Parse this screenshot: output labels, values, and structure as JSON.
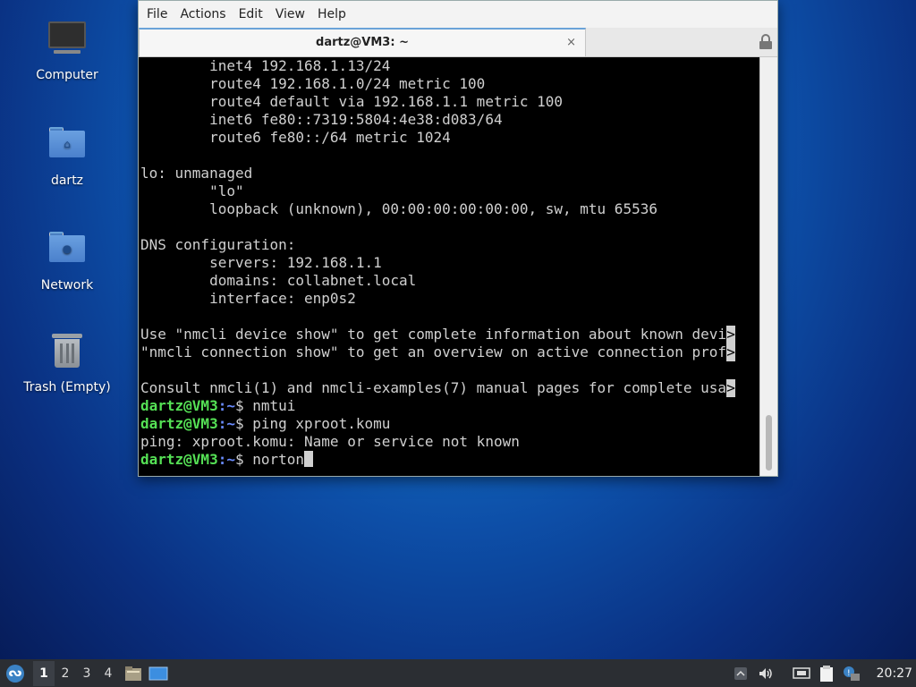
{
  "desktop": {
    "icons": [
      {
        "label": "Computer"
      },
      {
        "label": "dartz"
      },
      {
        "label": "Network"
      },
      {
        "label": "Trash (Empty)"
      }
    ]
  },
  "window": {
    "menu": [
      "File",
      "Actions",
      "Edit",
      "View",
      "Help"
    ],
    "tab_title": "dartz@VM3: ~",
    "tab_close": "×",
    "terminal": {
      "lines": [
        "        inet4 192.168.1.13/24",
        "        route4 192.168.1.0/24 metric 100",
        "        route4 default via 192.168.1.1 metric 100",
        "        inet6 fe80::7319:5804:4e38:d083/64",
        "        route6 fe80::/64 metric 1024",
        "",
        "lo: unmanaged",
        "        \"lo\"",
        "        loopback (unknown), 00:00:00:00:00:00, sw, mtu 65536",
        "",
        "DNS configuration:",
        "        servers: 192.168.1.1",
        "        domains: collabnet.local",
        "        interface: enp0s2",
        "",
        "Use \"nmcli device show\" to get complete information about known devi",
        "\"nmcli connection show\" to get an overview on active connection prof",
        "",
        "Consult nmcli(1) and nmcli-examples(7) manual pages for complete usa"
      ],
      "trunc_marker": ">",
      "prompt_user": "dartz@VM3",
      "prompt_path": ":~",
      "prompt_symbol": "$ ",
      "commands": [
        {
          "cmd": "nmtui"
        },
        {
          "cmd": "ping xproot.komu"
        }
      ],
      "error_line": "ping: xproot.komu: Name or service not known",
      "current_input": "norton"
    }
  },
  "taskbar": {
    "workspaces": [
      "1",
      "2",
      "3",
      "4"
    ],
    "active_workspace": "1",
    "clock": "20:27"
  }
}
